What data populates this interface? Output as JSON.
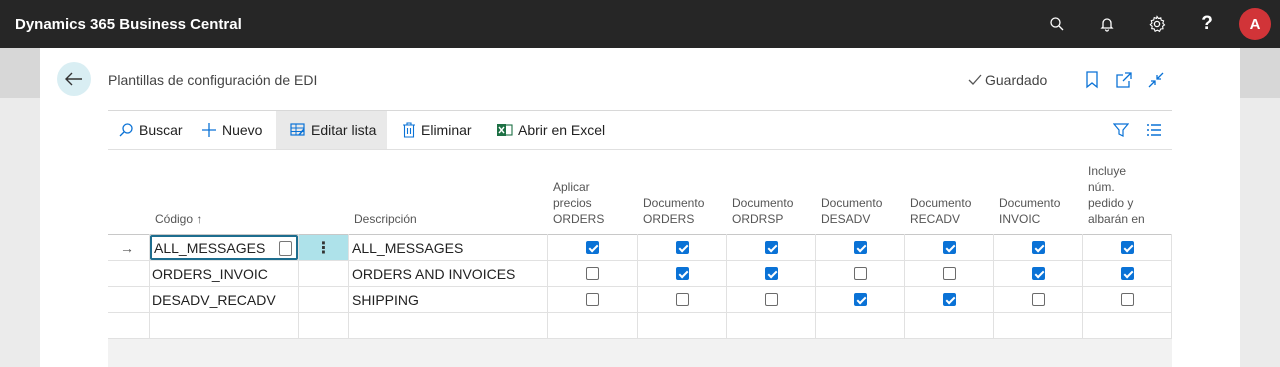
{
  "app": {
    "title": "Dynamics 365 Business Central",
    "avatar_letter": "A"
  },
  "appbar_icons": [
    "search-icon",
    "bell-icon",
    "gear-icon",
    "help-icon"
  ],
  "page": {
    "title": "Plantillas de configuración de EDI",
    "saved_label": "Guardado"
  },
  "actions": {
    "search": "Buscar",
    "new": "Nuevo",
    "edit_list": "Editar lista",
    "delete": "Eliminar",
    "open_excel": "Abrir en Excel"
  },
  "columns": {
    "code": "Código",
    "description": "Descripción",
    "apply_prices": [
      "Aplicar",
      "precios",
      "ORDERS"
    ],
    "doc_orders": [
      "Documento",
      "ORDERS"
    ],
    "doc_ordrsp": [
      "Documento",
      "ORDRSP"
    ],
    "doc_desadv": [
      "Documento",
      "DESADV"
    ],
    "doc_recadv": [
      "Documento",
      "RECADV"
    ],
    "doc_invoic": [
      "Documento",
      "INVOIC"
    ],
    "includes": [
      "Incluye",
      "núm.",
      "pedido y",
      "albarán en"
    ]
  },
  "rows": [
    {
      "code": "ALL_MESSAGES",
      "description": "ALL_MESSAGES",
      "checks": [
        true,
        true,
        true,
        true,
        true,
        true,
        true
      ]
    },
    {
      "code": "ORDERS_INVOIC",
      "description": "ORDERS AND INVOICES",
      "checks": [
        false,
        true,
        true,
        false,
        false,
        true,
        true
      ]
    },
    {
      "code": "DESADV_RECADV",
      "description": "SHIPPING",
      "checks": [
        false,
        false,
        false,
        true,
        true,
        false,
        false
      ]
    }
  ],
  "colors": {
    "accent": "#0a72d6",
    "appbar": "#262626",
    "avatar": "#d13438",
    "selection": "#aee2ea"
  }
}
